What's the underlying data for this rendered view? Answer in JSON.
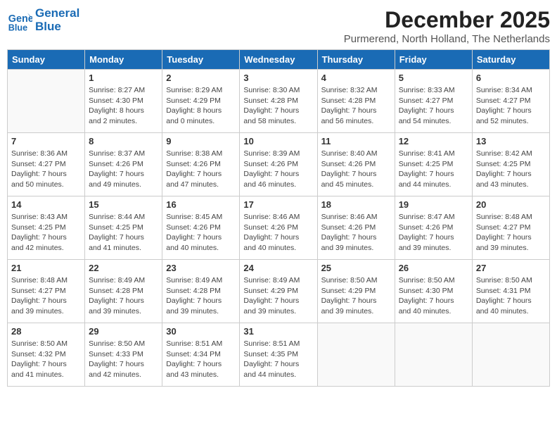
{
  "header": {
    "logo_line1": "General",
    "logo_line2": "Blue",
    "month_year": "December 2025",
    "location": "Purmerend, North Holland, The Netherlands"
  },
  "days_of_week": [
    "Sunday",
    "Monday",
    "Tuesday",
    "Wednesday",
    "Thursday",
    "Friday",
    "Saturday"
  ],
  "weeks": [
    [
      {
        "day": "",
        "info": ""
      },
      {
        "day": "1",
        "info": "Sunrise: 8:27 AM\nSunset: 4:30 PM\nDaylight: 8 hours\nand 2 minutes."
      },
      {
        "day": "2",
        "info": "Sunrise: 8:29 AM\nSunset: 4:29 PM\nDaylight: 8 hours\nand 0 minutes."
      },
      {
        "day": "3",
        "info": "Sunrise: 8:30 AM\nSunset: 4:28 PM\nDaylight: 7 hours\nand 58 minutes."
      },
      {
        "day": "4",
        "info": "Sunrise: 8:32 AM\nSunset: 4:28 PM\nDaylight: 7 hours\nand 56 minutes."
      },
      {
        "day": "5",
        "info": "Sunrise: 8:33 AM\nSunset: 4:27 PM\nDaylight: 7 hours\nand 54 minutes."
      },
      {
        "day": "6",
        "info": "Sunrise: 8:34 AM\nSunset: 4:27 PM\nDaylight: 7 hours\nand 52 minutes."
      }
    ],
    [
      {
        "day": "7",
        "info": "Sunrise: 8:36 AM\nSunset: 4:27 PM\nDaylight: 7 hours\nand 50 minutes."
      },
      {
        "day": "8",
        "info": "Sunrise: 8:37 AM\nSunset: 4:26 PM\nDaylight: 7 hours\nand 49 minutes."
      },
      {
        "day": "9",
        "info": "Sunrise: 8:38 AM\nSunset: 4:26 PM\nDaylight: 7 hours\nand 47 minutes."
      },
      {
        "day": "10",
        "info": "Sunrise: 8:39 AM\nSunset: 4:26 PM\nDaylight: 7 hours\nand 46 minutes."
      },
      {
        "day": "11",
        "info": "Sunrise: 8:40 AM\nSunset: 4:26 PM\nDaylight: 7 hours\nand 45 minutes."
      },
      {
        "day": "12",
        "info": "Sunrise: 8:41 AM\nSunset: 4:25 PM\nDaylight: 7 hours\nand 44 minutes."
      },
      {
        "day": "13",
        "info": "Sunrise: 8:42 AM\nSunset: 4:25 PM\nDaylight: 7 hours\nand 43 minutes."
      }
    ],
    [
      {
        "day": "14",
        "info": "Sunrise: 8:43 AM\nSunset: 4:25 PM\nDaylight: 7 hours\nand 42 minutes."
      },
      {
        "day": "15",
        "info": "Sunrise: 8:44 AM\nSunset: 4:25 PM\nDaylight: 7 hours\nand 41 minutes."
      },
      {
        "day": "16",
        "info": "Sunrise: 8:45 AM\nSunset: 4:26 PM\nDaylight: 7 hours\nand 40 minutes."
      },
      {
        "day": "17",
        "info": "Sunrise: 8:46 AM\nSunset: 4:26 PM\nDaylight: 7 hours\nand 40 minutes."
      },
      {
        "day": "18",
        "info": "Sunrise: 8:46 AM\nSunset: 4:26 PM\nDaylight: 7 hours\nand 39 minutes."
      },
      {
        "day": "19",
        "info": "Sunrise: 8:47 AM\nSunset: 4:26 PM\nDaylight: 7 hours\nand 39 minutes."
      },
      {
        "day": "20",
        "info": "Sunrise: 8:48 AM\nSunset: 4:27 PM\nDaylight: 7 hours\nand 39 minutes."
      }
    ],
    [
      {
        "day": "21",
        "info": "Sunrise: 8:48 AM\nSunset: 4:27 PM\nDaylight: 7 hours\nand 39 minutes."
      },
      {
        "day": "22",
        "info": "Sunrise: 8:49 AM\nSunset: 4:28 PM\nDaylight: 7 hours\nand 39 minutes."
      },
      {
        "day": "23",
        "info": "Sunrise: 8:49 AM\nSunset: 4:28 PM\nDaylight: 7 hours\nand 39 minutes."
      },
      {
        "day": "24",
        "info": "Sunrise: 8:49 AM\nSunset: 4:29 PM\nDaylight: 7 hours\nand 39 minutes."
      },
      {
        "day": "25",
        "info": "Sunrise: 8:50 AM\nSunset: 4:29 PM\nDaylight: 7 hours\nand 39 minutes."
      },
      {
        "day": "26",
        "info": "Sunrise: 8:50 AM\nSunset: 4:30 PM\nDaylight: 7 hours\nand 40 minutes."
      },
      {
        "day": "27",
        "info": "Sunrise: 8:50 AM\nSunset: 4:31 PM\nDaylight: 7 hours\nand 40 minutes."
      }
    ],
    [
      {
        "day": "28",
        "info": "Sunrise: 8:50 AM\nSunset: 4:32 PM\nDaylight: 7 hours\nand 41 minutes."
      },
      {
        "day": "29",
        "info": "Sunrise: 8:50 AM\nSunset: 4:33 PM\nDaylight: 7 hours\nand 42 minutes."
      },
      {
        "day": "30",
        "info": "Sunrise: 8:51 AM\nSunset: 4:34 PM\nDaylight: 7 hours\nand 43 minutes."
      },
      {
        "day": "31",
        "info": "Sunrise: 8:51 AM\nSunset: 4:35 PM\nDaylight: 7 hours\nand 44 minutes."
      },
      {
        "day": "",
        "info": ""
      },
      {
        "day": "",
        "info": ""
      },
      {
        "day": "",
        "info": ""
      }
    ]
  ]
}
